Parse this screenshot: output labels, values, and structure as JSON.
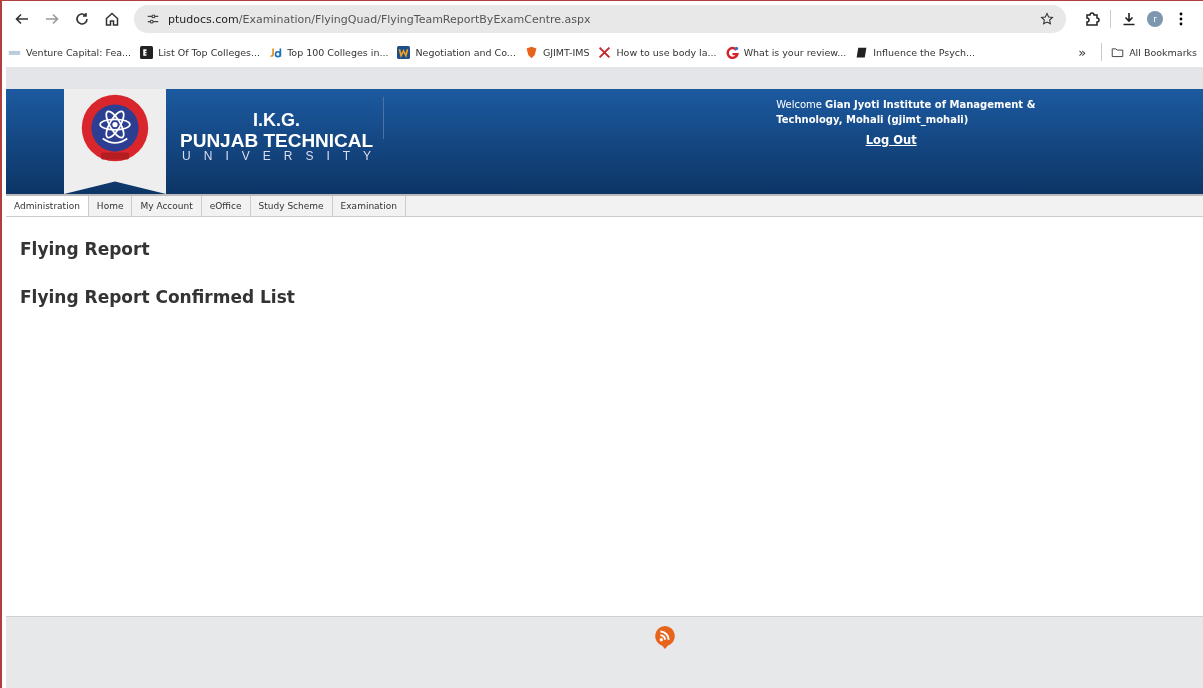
{
  "browser": {
    "url_host": "ptudocs.com",
    "url_path": "/Examination/FlyingQuad/FlyingTeamReportByExamCentre.aspx",
    "bookmarks": [
      {
        "label": "Venture Capital: Fea...",
        "kind": "edu"
      },
      {
        "label": "List Of Top Colleges...",
        "kind": "ek"
      },
      {
        "label": "Top 100 Colleges in...",
        "kind": "jd"
      },
      {
        "label": "Negotiation and Co...",
        "kind": "w"
      },
      {
        "label": "GJIMT-IMS",
        "kind": "shield"
      },
      {
        "label": "How to use body la...",
        "kind": "x"
      },
      {
        "label": "What is your review...",
        "kind": "g"
      },
      {
        "label": "Influence the Psych...",
        "kind": "book"
      }
    ],
    "overflow": "»",
    "all_bookmarks": "All Bookmarks",
    "avatar": "r"
  },
  "header": {
    "logo_line1": "I.K.G.",
    "logo_line2": "PUNJAB TECHNICAL",
    "logo_line3": "UNIVERSITY",
    "welcome": "Welcome **Gian Jyoti Institute of Management & Technology, Mohali (gjimt_mohali)**",
    "logout": "Log Out"
  },
  "tabs": [
    {
      "label": "Administration",
      "selected": true
    },
    {
      "label": "Home",
      "selected": false
    },
    {
      "label": "My Account",
      "selected": false
    },
    {
      "label": "eOffice",
      "selected": false
    },
    {
      "label": "Study Scheme",
      "selected": false
    },
    {
      "label": "Examination",
      "selected": false
    }
  ],
  "headings": [
    "Flying Report",
    "Flying Report Confirmed List"
  ]
}
